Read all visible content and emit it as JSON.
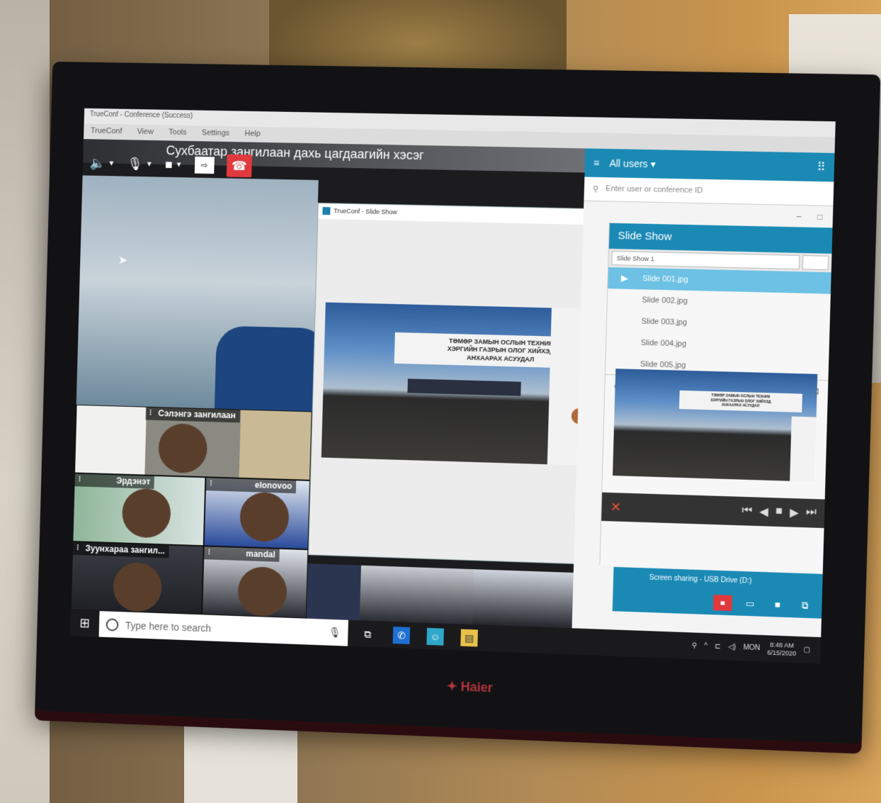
{
  "app": {
    "window_title": "TrueConf - Conference (Success)",
    "menu": [
      "TrueConf",
      "View",
      "Tools",
      "Settings",
      "Help"
    ],
    "conference_title": "Сухбаатар зангилаан дахь цагдаагийн хэсэг"
  },
  "controls": {
    "speaker_icon": "speaker-icon",
    "mic_icon": "microphone-icon",
    "camera_icon": "camera-icon",
    "share_icon": "share-screen-icon",
    "hangup_icon": "hangup-icon"
  },
  "participants": [
    {
      "name": "Сэлэнгэ зангилаан"
    },
    {
      "name": "Эрдэнэт"
    },
    {
      "name": "elonovoo"
    },
    {
      "name": "Зуунхараа зангил..."
    },
    {
      "name": "mandal"
    }
  ],
  "slide_window": {
    "title": "TrueConf - Slide Show",
    "slide_caption": "ТӨМӨР ЗАМЫН ОСЛЫН ТЕХНИК\nХЭРГИЙН ГАЗРЫН ОЛОГ ХИЙХЭД\nАНХААРАХ АСУУДАЛ"
  },
  "sidebar": {
    "users_label": "All users",
    "search_placeholder": "Enter user or conference ID",
    "slide_show_title": "Slide Show",
    "slide_show_name": "Slide Show 1",
    "slides": [
      "Slide 001.jpg",
      "Slide 002.jpg",
      "Slide 003.jpg",
      "Slide 004.jpg",
      "Slide 005.jpg"
    ],
    "active_slide": 0,
    "screen_sharing_label": "Screen sharing - USB Drive (D:)"
  },
  "taskbar": {
    "search_placeholder": "Type here to search",
    "time": "8:48 AM",
    "date": "6/15/2020",
    "lang": "MON"
  },
  "monitor": {
    "brand": "Haier"
  },
  "colors": {
    "accent": "#1a8ab5",
    "hangup": "#e0393e",
    "active_slide": "#6cc1e4"
  }
}
